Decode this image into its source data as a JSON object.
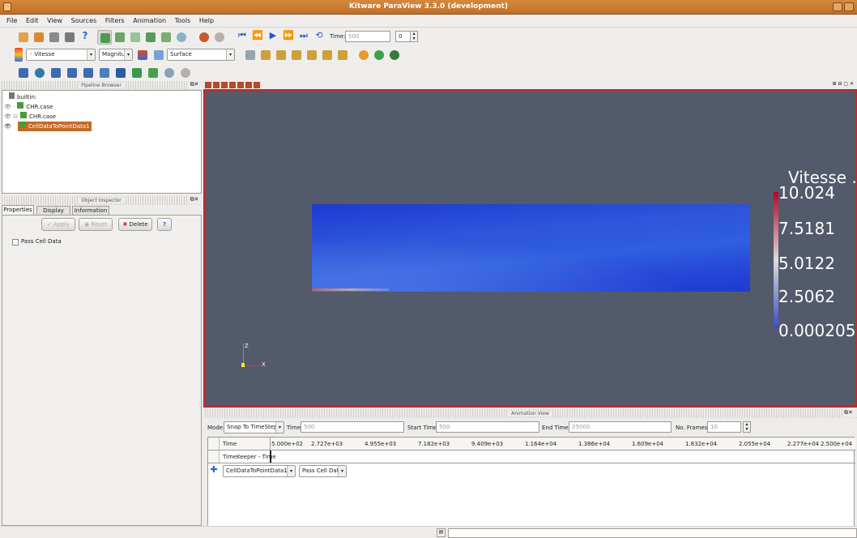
{
  "window": {
    "title": "Kitware ParaView 3.3.0 (development)"
  },
  "menu": [
    "File",
    "Edit",
    "View",
    "Sources",
    "Filters",
    "Animation",
    "Tools",
    "Help"
  ],
  "toolbar": {
    "time_label": "Time:",
    "time_value": "500",
    "step_value": "0",
    "array_name": "◦ Vitesse",
    "component": "Magnitu",
    "representation": "Surface"
  },
  "pipeline": {
    "title": "Pipeline Browser",
    "items": [
      "builtin:",
      "CHR.case",
      "CHR.case",
      "CellDataToPointData1"
    ]
  },
  "inspector": {
    "title": "Object Inspector",
    "tabs": [
      "Properties",
      "Display",
      "Information"
    ],
    "apply": "Apply",
    "reset": "Reset",
    "delete": "Delete",
    "help": "?",
    "pass_cell_data": "Pass Cell Data"
  },
  "legend": {
    "title": "Vitesse ...",
    "labels": [
      "10.024",
      "7.5181",
      "5.0122",
      "2.5062",
      "0.000205"
    ],
    "colors": {
      "top": "#b40426",
      "mid": "#dddcdc",
      "bottom": "#3b4cc0"
    }
  },
  "axes": {
    "z": "Z",
    "x": "X"
  },
  "animation": {
    "title": "Animation View",
    "mode_label": "Mode:",
    "mode_value": "Snap To TimeSteps",
    "time_label": "Time:",
    "time_value": "500",
    "start_label": "Start Time:",
    "start_value": "500",
    "end_label": "End Time:",
    "end_value": "25000",
    "frames_label": "No. Frames:",
    "frames_value": "10",
    "row_time": "Time",
    "row_keeper": "TimeKeeper - Time",
    "ticks": [
      "5.000e+02",
      "2.727e+03",
      "4.955e+03",
      "7.182e+03",
      "9.409e+03",
      "1.164e+04",
      "1.386e+04",
      "1.609e+04",
      "1.832e+04",
      "2.055e+04",
      "2.277e+04",
      "2.500e+04"
    ],
    "source_select": "CellDataToPointData1",
    "property_select": "Pass Cell Data"
  }
}
